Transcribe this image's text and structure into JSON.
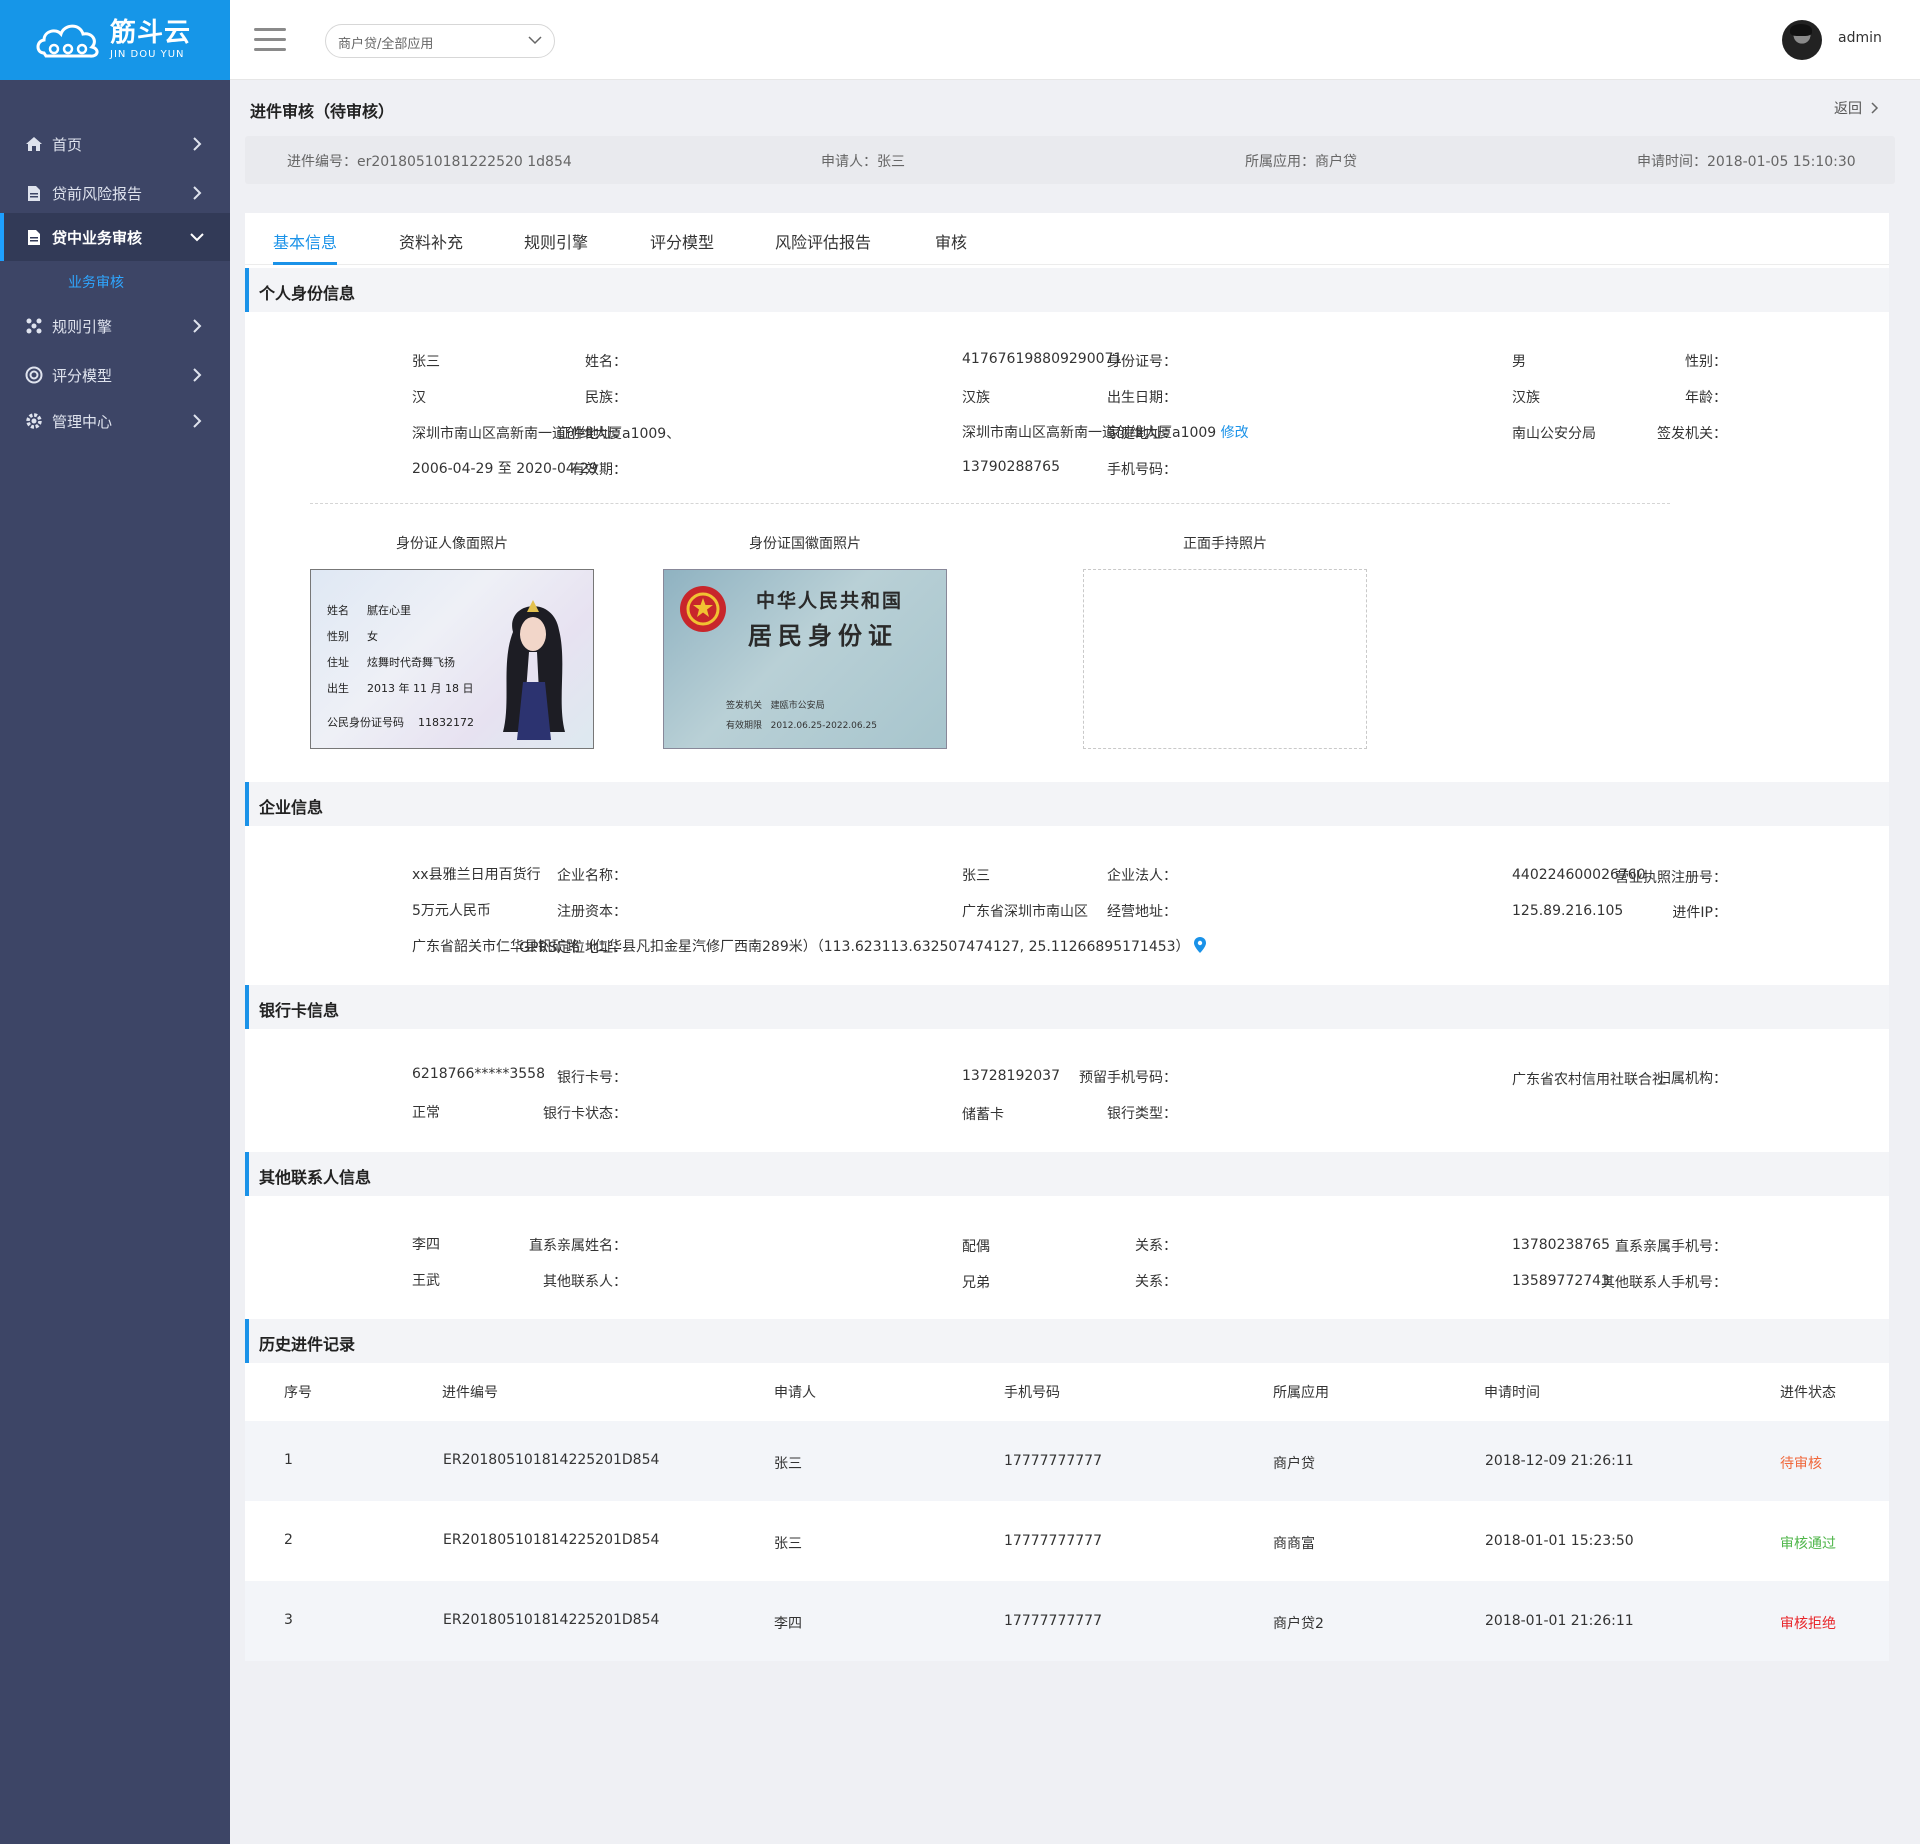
{
  "brand": {
    "name": "筋斗云",
    "sub": "JIN DOU YUN"
  },
  "sidebar": {
    "items": [
      {
        "label": "首页",
        "icon": "home-icon"
      },
      {
        "label": "贷前风险报告",
        "icon": "document-icon"
      },
      {
        "label": "贷中业务审核",
        "icon": "document-icon",
        "active": true
      },
      {
        "label": "规则引擎",
        "icon": "network-icon"
      },
      {
        "label": "评分模型",
        "icon": "target-icon"
      },
      {
        "label": "管理中心",
        "icon": "gear-icon"
      }
    ],
    "submenu": [
      {
        "label": "业务审核"
      }
    ]
  },
  "topbar": {
    "app_select": "商户贷/全部应用",
    "user": "admin"
  },
  "page": {
    "title": "进件审核（待审核）",
    "back": "返回",
    "info": {
      "id": "进件编号：er20180510181222520 1d854",
      "applicant": "申请人：张三",
      "app": "所属应用：商户贷",
      "time": "申请时间：2018-01-05 15:10:30"
    }
  },
  "tabs": [
    "基本信息",
    "资料补充",
    "规则引擎",
    "评分模型",
    "风险评估报告",
    "审核"
  ],
  "sections": {
    "personal": "个人身份信息",
    "enterprise": "企业信息",
    "bank": "银行卡信息",
    "contacts": "其他联系人信息",
    "history": "历史进件记录"
  },
  "personal": {
    "name_l": "姓名：",
    "name": "张三",
    "idno_l": "身份证号：",
    "idno": "417676198809290071",
    "gender_l": "性别：",
    "gender": "男",
    "nation_l": "民族：",
    "nation": "汉",
    "birth_l": "出生日期：",
    "birth": "汉族",
    "age_l": "年龄：",
    "age": "汉族",
    "idaddr_l": "证件地址：",
    "idaddr": "深圳市南山区高新南一道创维大厦a1009、",
    "home_l": "家庭地址：",
    "home": "深圳市南山区高新南一道创维大厦a1009",
    "edit": "修改",
    "issuer_l": "签发机关：",
    "issuer": "南山公安分局",
    "valid_l": "有效期：",
    "valid": "2006-04-29  至  2020-04-29",
    "phone_l": "手机号码：",
    "phone": "13790288765"
  },
  "photos": {
    "front_title": "身份证人像面照片",
    "back_title": "身份证国徽面照片",
    "hold_title": "正面手持照片",
    "front": {
      "name_k": "姓名",
      "name_v": "腻在心里",
      "sex_k": "性别",
      "sex_v": "女",
      "addr_k": "住址",
      "addr_v": "炫舞时代奇舞飞扬",
      "birth_k": "出生",
      "birth_v": "2013 年 11 月 18 日",
      "no_k": "公民身份证号码",
      "no_v": "11832172"
    },
    "back": {
      "line1": "中华人民共和国",
      "line2": "居民身份证",
      "issuer_k": "签发机关",
      "issuer_v": "建瓯市公安局",
      "valid_k": "有效期限",
      "valid_v": "2012.06.25-2022.06.25"
    }
  },
  "enterprise": {
    "name_l": "企业名称：",
    "name": "xx县雅兰日用百货行",
    "legal_l": "企业法人：",
    "legal": "张三",
    "license_l": "营业执照注册号：",
    "license": "440224600026760",
    "capital_l": "注册资本：",
    "capital": "5万元人民币",
    "addr_l": "经营地址：",
    "addr": "广东省深圳市南山区",
    "ip_l": "进件IP：",
    "ip": "125.89.216.105",
    "gprs_l": "GPRS定位地址：",
    "gprs": "广东省韶关市仁华县钒矿路（仁华县凡扣金星汽修厂西南289米）（113.623113.632507474127, 25.11266895171453）"
  },
  "bank": {
    "card_l": "银行卡号：",
    "card": "6218766*****3558",
    "phone_l": "预留手机号码：",
    "phone": "13728192037",
    "org_l": "归属机构：",
    "org": "广东省农村信用社联合社",
    "status_l": "银行卡状态：",
    "status": "正常",
    "type_l": "银行类型：",
    "type": "储蓄卡"
  },
  "contacts": {
    "rel_name_l": "直系亲属姓名：",
    "rel_name": "李四",
    "rel1_l": "关系：",
    "rel1": "配偶",
    "rel_phone_l": "直系亲属手机号：",
    "rel_phone": "13780238765",
    "other_l": "其他联系人：",
    "other": "王武",
    "rel2_l": "关系：",
    "rel2": "兄弟",
    "other_phone_l": "其他联系人手机号：",
    "other_phone": "13589772743"
  },
  "history": {
    "columns": [
      "序号",
      "进件编号",
      "申请人",
      "手机号码",
      "所属应用",
      "申请时间",
      "进件状态"
    ],
    "rows": [
      [
        "1",
        "ER201805101814225201D854",
        "张三",
        "17777777777",
        "商户贷",
        "2018-12-09  21:26:11",
        "待审核"
      ],
      [
        "2",
        "ER201805101814225201D854",
        "张三",
        "17777777777",
        "商商富",
        "2018-01-01  15:23:50",
        "审核通过"
      ],
      [
        "3",
        "ER201805101814225201D854",
        "李四",
        "17777777777",
        "商户贷2",
        "2018-01-01  21:26:11",
        "审核拒绝"
      ]
    ]
  },
  "colors": {
    "brand": "#1696e8",
    "sidebar": "#3d4566",
    "accent": "#1a92e8",
    "pending": "#f0683c",
    "pass": "#4fb64a",
    "reject": "#e8262b"
  }
}
